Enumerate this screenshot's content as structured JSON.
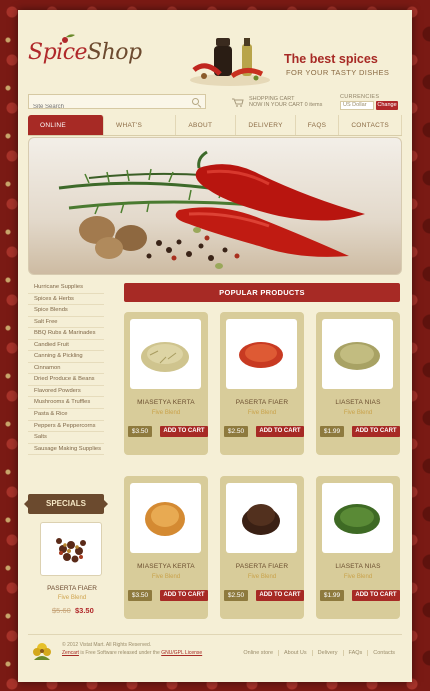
{
  "header": {
    "logo_spice": "Spice",
    "logo_shop": "Shop",
    "tagline": "The best spices",
    "tagline_sub": "FOR YOUR TASTY DISHES"
  },
  "search": {
    "placeholder": "Site Search"
  },
  "cart": {
    "title": "SHOPPING CART",
    "summary": "NOW IN YOUR CART 0 items"
  },
  "currency": {
    "label": "CURRENCIES",
    "selected": "US Dollar",
    "change_label": "Change"
  },
  "nav": {
    "items": [
      {
        "label": "ONLINE STORE"
      },
      {
        "label": "WHAT'S NEW?"
      },
      {
        "label": "ABOUT US"
      },
      {
        "label": "DELIVERY"
      },
      {
        "label": "FAQS"
      },
      {
        "label": "CONTACTS"
      }
    ]
  },
  "categories": [
    "Hurricane Supplies",
    "Spices & Herbs",
    "Spice Blends",
    "Salt Free",
    "BBQ Rubs & Marinades",
    "Candied Fruit",
    "Canning & Pickling",
    "Cinnamon",
    "Dried Produce & Beans",
    "Flavored Powders",
    "Mushrooms & Truffles",
    "Pasta & Rice",
    "Peppers & Peppercorns",
    "Salts",
    "Sausage Making Supplies"
  ],
  "specials": {
    "heading": "SPECIALS",
    "name": "PASERTA FIAER",
    "sub": "Five Blend",
    "old_price": "$5.60",
    "new_price": "$3.50"
  },
  "products": {
    "heading": "POPULAR PRODUCTS",
    "add_label": "ADD TO CART",
    "items": [
      {
        "name": "MIASETYA KERTA",
        "sub": "Five Blend",
        "price": "$3.50",
        "color": "#d9cf9e"
      },
      {
        "name": "PASERTA FIAER",
        "sub": "Five Blend",
        "price": "$2.50",
        "color": "#d54a2a"
      },
      {
        "name": "LIASETA NIAS",
        "sub": "Five Blend",
        "price": "$1.99",
        "color": "#b8b270"
      },
      {
        "name": "MIASETYA KERTA",
        "sub": "Five Blend",
        "price": "$3.50",
        "color": "#e0a24a"
      },
      {
        "name": "PASERTA FIAER",
        "sub": "Five Blend",
        "price": "$2.50",
        "color": "#4a2a1a"
      },
      {
        "name": "LIASETA NIAS",
        "sub": "Five Blend",
        "price": "$1.99",
        "color": "#4e7a2e"
      }
    ]
  },
  "footer": {
    "copyright": "© 2012 Vistat Mart. All Rights Reserved.",
    "license_prefix": "Zencart",
    "license_text": " is Free Software released under the ",
    "license_link": "GNU/GPL License",
    "nav": [
      "Online store",
      "About Us",
      "Delivery",
      "FAQs",
      "Contacts"
    ]
  }
}
